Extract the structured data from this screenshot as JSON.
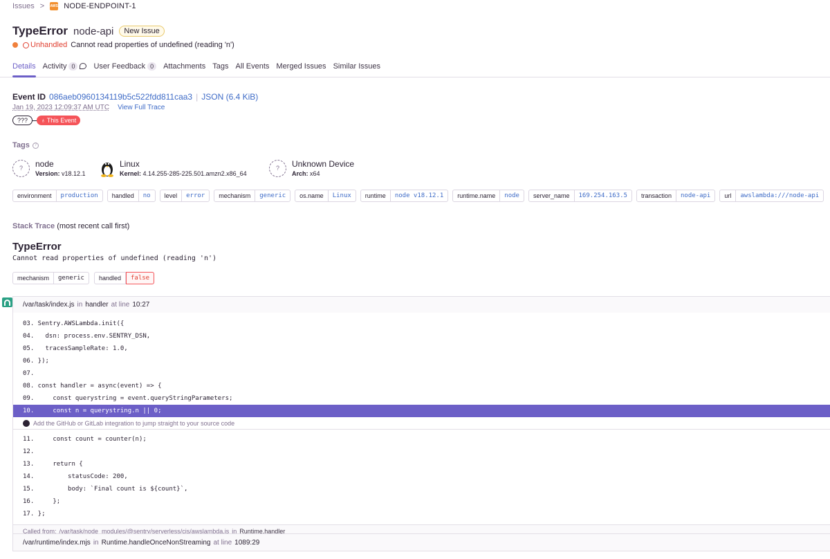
{
  "breadcrumb": {
    "issues": "Issues",
    "separator": ">",
    "aws_logo": "AWS",
    "project": "NODE-ENDPOINT-1"
  },
  "header": {
    "title": "TypeError",
    "culprit": "node-api",
    "badge": "New Issue",
    "unhandled": "Unhandled",
    "message": "Cannot read properties of undefined (reading 'n')"
  },
  "tabs": [
    {
      "label": "Details",
      "active": true
    },
    {
      "label": "Activity",
      "count": "0"
    },
    {
      "label": "User Feedback",
      "count": "0"
    },
    {
      "label": "Attachments"
    },
    {
      "label": "Tags"
    },
    {
      "label": "All Events"
    },
    {
      "label": "Merged Issues"
    },
    {
      "label": "Similar Issues"
    }
  ],
  "event": {
    "id_label": "Event ID",
    "id": "086aeb0960134119b5c522fdd811caa3",
    "divider": "|",
    "json": "JSON (6.4 KiB)",
    "date": "Jan 19, 2023 12:09:37 AM UTC",
    "full_trace": "View Full Trace",
    "timeline_prev": "???",
    "timeline_current": "This Event"
  },
  "tags_section": {
    "label": "Tags",
    "contexts": [
      {
        "icon": "?",
        "name": "node",
        "sub_key": "Version:",
        "sub_val": "v18.12.1"
      },
      {
        "icon": "linux-tux-icon",
        "name": "Linux",
        "sub_key": "Kernel:",
        "sub_val": "4.14.255-285-225.501.amzn2.x86_64"
      },
      {
        "icon": "?",
        "name": "Unknown Device",
        "sub_key": "Arch:",
        "sub_val": "x64"
      }
    ],
    "tags": [
      {
        "k": "environment",
        "v": "production"
      },
      {
        "k": "handled",
        "v": "no"
      },
      {
        "k": "level",
        "v": "error"
      },
      {
        "k": "mechanism",
        "v": "generic"
      },
      {
        "k": "os.name",
        "v": "Linux"
      },
      {
        "k": "runtime",
        "v": "node v18.12.1"
      },
      {
        "k": "runtime.name",
        "v": "node"
      },
      {
        "k": "server_name",
        "v": "169.254.163.5"
      },
      {
        "k": "transaction",
        "v": "node-api"
      },
      {
        "k": "url",
        "v": "awslambda:///node-api"
      }
    ]
  },
  "stack": {
    "label": "Stack Trace",
    "label_note": "(most recent call first)",
    "exception": "TypeError",
    "message": "Cannot read properties of undefined (reading 'n')",
    "mechanism_tags": [
      {
        "k": "mechanism",
        "v": "generic"
      },
      {
        "k": "handled",
        "v": "false"
      }
    ],
    "frame1": {
      "file": "/var/task/index.js",
      "in": "in",
      "function": "handler",
      "at_line": "at line",
      "line": "10:27",
      "code_before": [
        "03. Sentry.AWSLambda.init({",
        "04.   dsn: process.env.SENTRY_DSN,",
        "05.   tracesSampleRate: 1.0,",
        "06. });",
        "07.",
        "08. const handler = async(event) => {",
        "09.     const querystring = event.queryStringParameters;"
      ],
      "active_line": "10.     const n = querystring.n || 0;",
      "integration_hint": "Add the GitHub or GitLab integration to jump straight to your source code",
      "code_after": [
        "11.     const count = counter(n);",
        "12.",
        "13.     return {",
        "14.         statusCode: 200,",
        "15.         body: `Final count is ${count}`,",
        "16.     };",
        "17. };"
      ],
      "called_from_label": "Called from:",
      "called_from_file": "/var/task/node_modules/@sentry/serverless/cjs/awslambda.js",
      "called_from_in": "in",
      "called_from_fn": "Runtime.handler"
    },
    "frame2": {
      "file": "/var/runtime/index.mjs",
      "in": "in",
      "function": "Runtime.handleOnceNonStreaming",
      "at_line": "at line",
      "line": "1089:29"
    }
  }
}
